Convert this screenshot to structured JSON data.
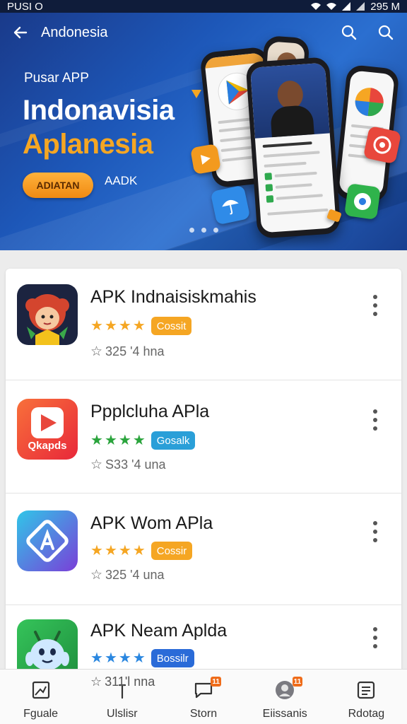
{
  "status_bar": {
    "left_text": "PUSI O",
    "time": "295 M"
  },
  "header": {
    "title": "Andonesia",
    "back_icon": "arrow-left-icon",
    "actions": [
      "search-icon",
      "search-icon"
    ]
  },
  "banner": {
    "subtitle": "Pusar APP",
    "title_line1": "Indonavisia",
    "title_line2": "Aplanesia",
    "cta_label": "ADIATAN",
    "secondary_label": "AADK",
    "accent": "#f5a623",
    "dots": 3
  },
  "apps": [
    {
      "name": "APK Indnaisiskmahis",
      "star_count": 4,
      "star_color": "#f5a623",
      "badge": "Cossit",
      "badge_color": "#f5a623",
      "meta": "325 '4 hna",
      "icon": "cartoon-girl-icon",
      "icon_bg": "#1c2440"
    },
    {
      "name": "Ppplcluha APla",
      "star_count": 4,
      "star_color": "#2aa43c",
      "badge": "Gosalk",
      "badge_color": "#2a9fd8",
      "meta": "S33 '4 una",
      "icon": "play-store-icon",
      "icon_label": "Qkapds",
      "icon_bg": "#f04a2e"
    },
    {
      "name": "APK Wom APla",
      "star_count": 4,
      "star_color": "#f5a623",
      "badge": "Cossir",
      "badge_color": "#f5a623",
      "meta": "325 '4 una",
      "icon": "diamond-a-icon",
      "icon_bg": "#3f6fe8"
    },
    {
      "name": "APK Neam Aplda",
      "star_count": 4,
      "star_color": "#2a87e0",
      "badge": "Bossilr",
      "badge_color": "#2a6bd8",
      "meta": "311'l nna",
      "icon": "robot-mascot-icon",
      "icon_bg": "#2fae4a"
    }
  ],
  "bottom_nav": [
    {
      "label": "Fguale",
      "icon": "image-frame-icon"
    },
    {
      "label": "Ulslisr",
      "icon": "pen-icon"
    },
    {
      "label": "Storn",
      "icon": "chat-icon",
      "badge": "11"
    },
    {
      "label": "Eiissanis",
      "icon": "avatar-icon",
      "badge": "11"
    },
    {
      "label": "Rdotag",
      "icon": "document-icon"
    }
  ]
}
